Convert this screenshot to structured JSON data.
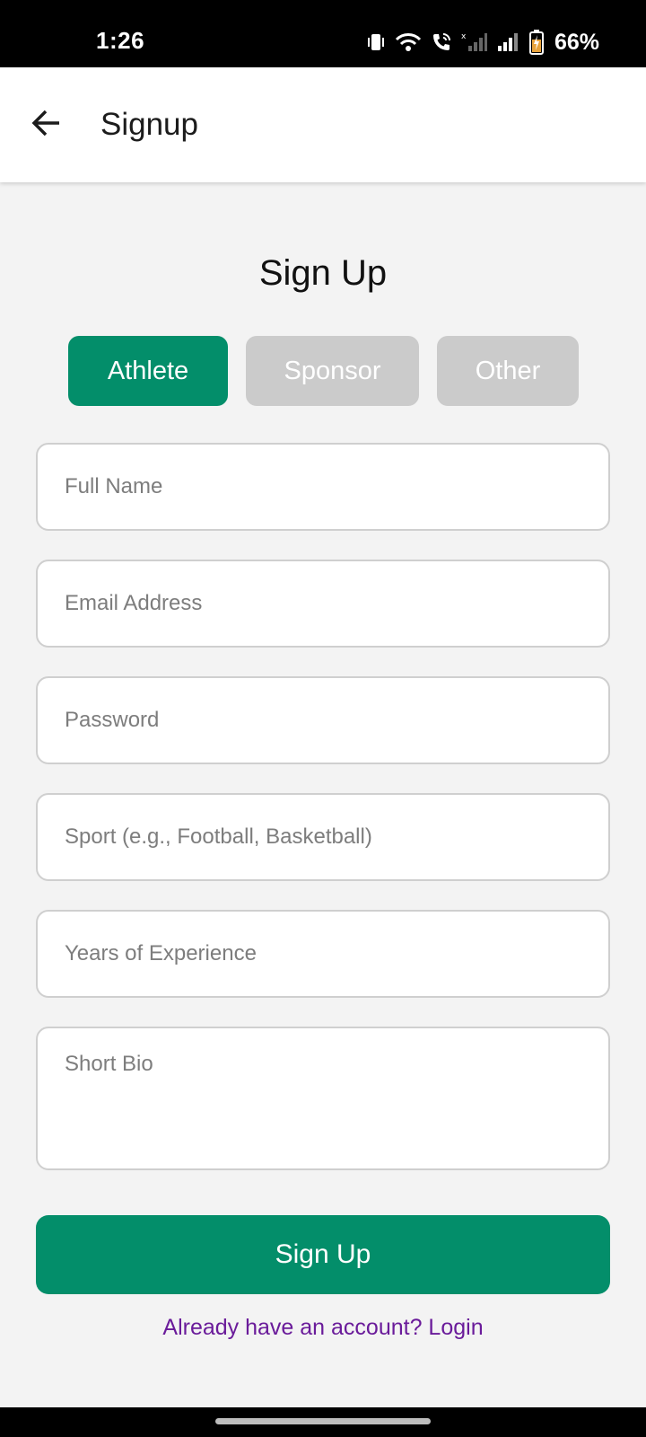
{
  "status_bar": {
    "time": "1:26",
    "battery_percent": "66%",
    "icons": [
      "vibrate-icon",
      "wifi-icon",
      "wifi-calling-icon",
      "signal-sim1-icon",
      "signal-sim2-icon",
      "battery-charging-icon"
    ]
  },
  "app_bar": {
    "back_icon": "arrow-back-icon",
    "title": "Signup"
  },
  "form": {
    "heading": "Sign Up",
    "roles": {
      "athlete": "Athlete",
      "sponsor": "Sponsor",
      "other": "Other",
      "selected": "Athlete"
    },
    "fields": {
      "full_name": {
        "placeholder": "Full Name",
        "value": ""
      },
      "email": {
        "placeholder": "Email Address",
        "value": ""
      },
      "password": {
        "placeholder": "Password",
        "value": ""
      },
      "sport": {
        "placeholder": "Sport (e.g., Football, Basketball)",
        "value": ""
      },
      "experience": {
        "placeholder": "Years of Experience",
        "value": ""
      },
      "bio": {
        "placeholder": "Short Bio",
        "value": ""
      }
    },
    "submit_label": "Sign Up",
    "login_link": "Already have an account? Login"
  },
  "colors": {
    "accent": "#038e6a",
    "inactive_toggle": "#cbcbcb",
    "link": "#6a1b9a",
    "background": "#f3f3f3"
  }
}
